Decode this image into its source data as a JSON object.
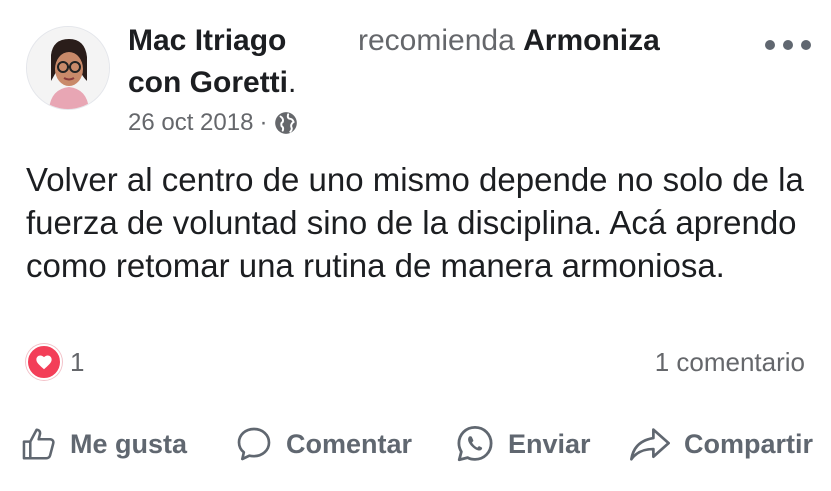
{
  "post": {
    "author": "Mac Itriago con Goretti",
    "author_line1": "Mac Itriago",
    "author_line2": "con Goretti",
    "author_dot": ".",
    "recommends_label": "recomienda",
    "page_name": "Armoniza",
    "date": "26 oct 2018",
    "separator": "·",
    "privacy_icon": "globe-icon",
    "body": "Volver al centro de uno mismo depende no solo de la fuerza de voluntad sino de la disciplina. Acá aprendo como retomar una rutina de manera armoniosa.",
    "more_icon": "more-options-icon"
  },
  "reactions": {
    "icon": "heart-icon",
    "count": "1",
    "comments": "1 comentario",
    "heart_color": "#f33e58"
  },
  "actions": {
    "like": "Me gusta",
    "comment": "Comentar",
    "send": "Enviar",
    "share": "Compartir"
  }
}
